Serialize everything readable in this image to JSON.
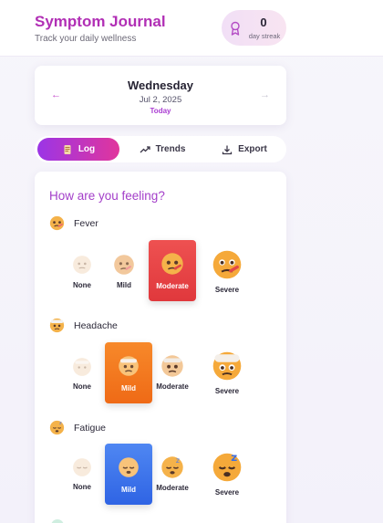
{
  "header": {
    "title": "Symptom Journal",
    "subtitle": "Track your daily wellness",
    "streak_count": "0",
    "streak_label": "day streak"
  },
  "date": {
    "weekday": "Wednesday",
    "full": "Jul 2, 2025",
    "today": "Today",
    "prev_icon": "←",
    "next_icon": "→"
  },
  "tabs": [
    {
      "label": "Log",
      "icon": "notebook-icon"
    },
    {
      "label": "Trends",
      "icon": "trend-icon"
    },
    {
      "label": "Export",
      "icon": "download-icon"
    }
  ],
  "panel": {
    "title": "How are you feeling?"
  },
  "severity_labels": [
    "None",
    "Mild",
    "Moderate",
    "Severe"
  ],
  "symptoms": [
    {
      "name": "Fever",
      "selected": "Moderate"
    },
    {
      "name": "Headache",
      "selected": "Mild"
    },
    {
      "name": "Fatigue",
      "selected": "Mild"
    }
  ]
}
